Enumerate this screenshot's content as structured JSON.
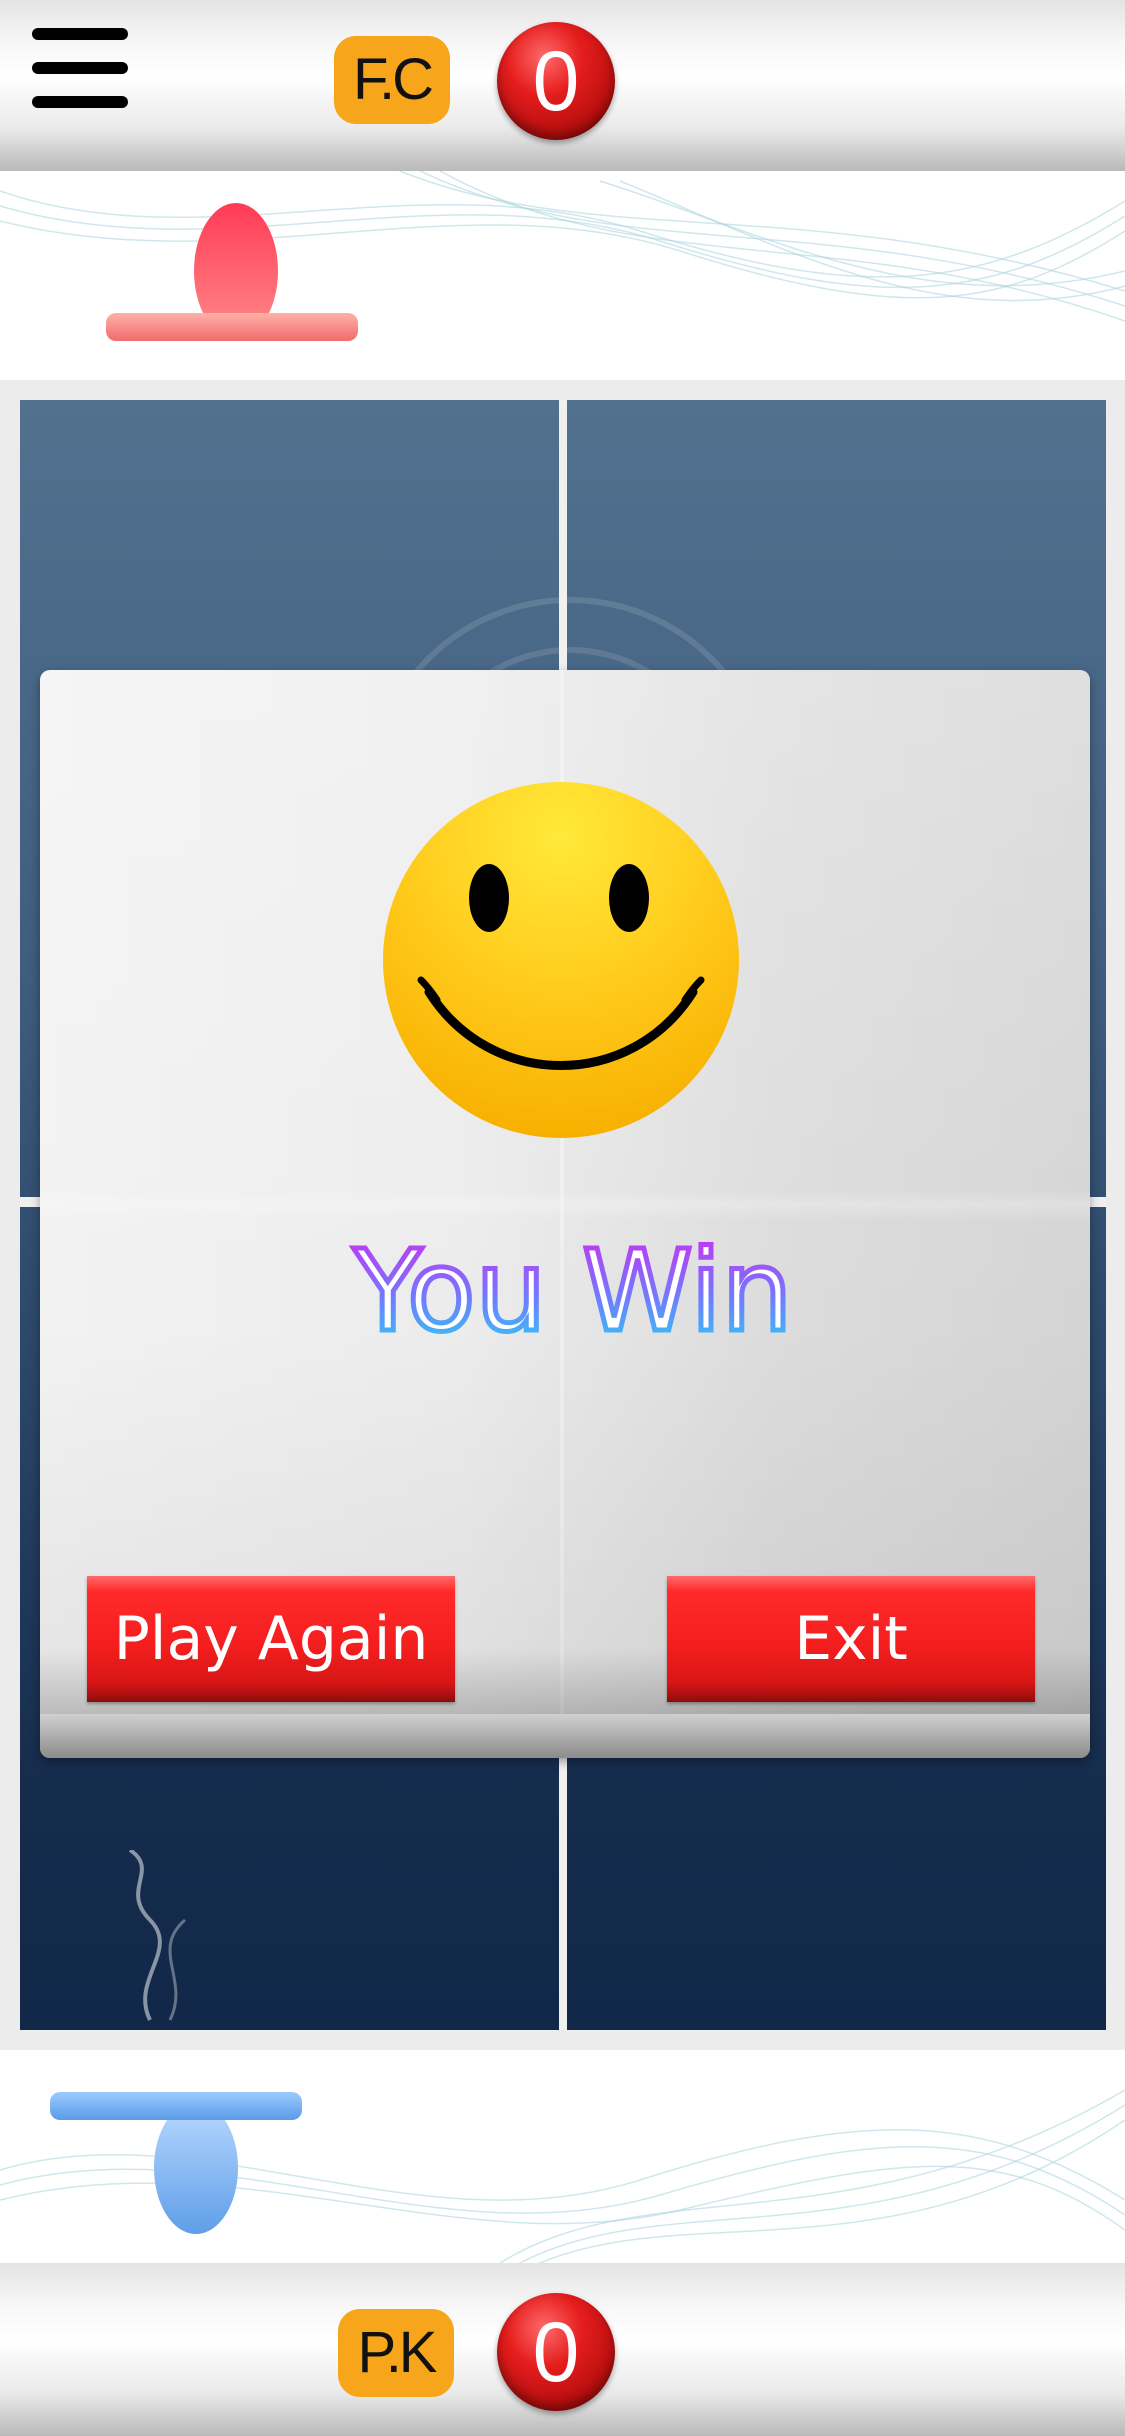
{
  "top_bar": {
    "player_name": "F.C",
    "player_score": "0",
    "menu_icon": "hamburger-menu-icon",
    "paddle_color": "#ff5b6a"
  },
  "bottom_bar": {
    "player_name": "P.K",
    "player_score": "0",
    "paddle_color": "#7fb6f2"
  },
  "board": {
    "field_color": "#3f5d7e",
    "line_color": "#f0f0f0"
  },
  "dialog": {
    "icon": "smiley-face-icon",
    "title": "You Win",
    "play_again_label": "Play Again",
    "exit_label": "Exit",
    "button_color": "#ff2a2a"
  }
}
